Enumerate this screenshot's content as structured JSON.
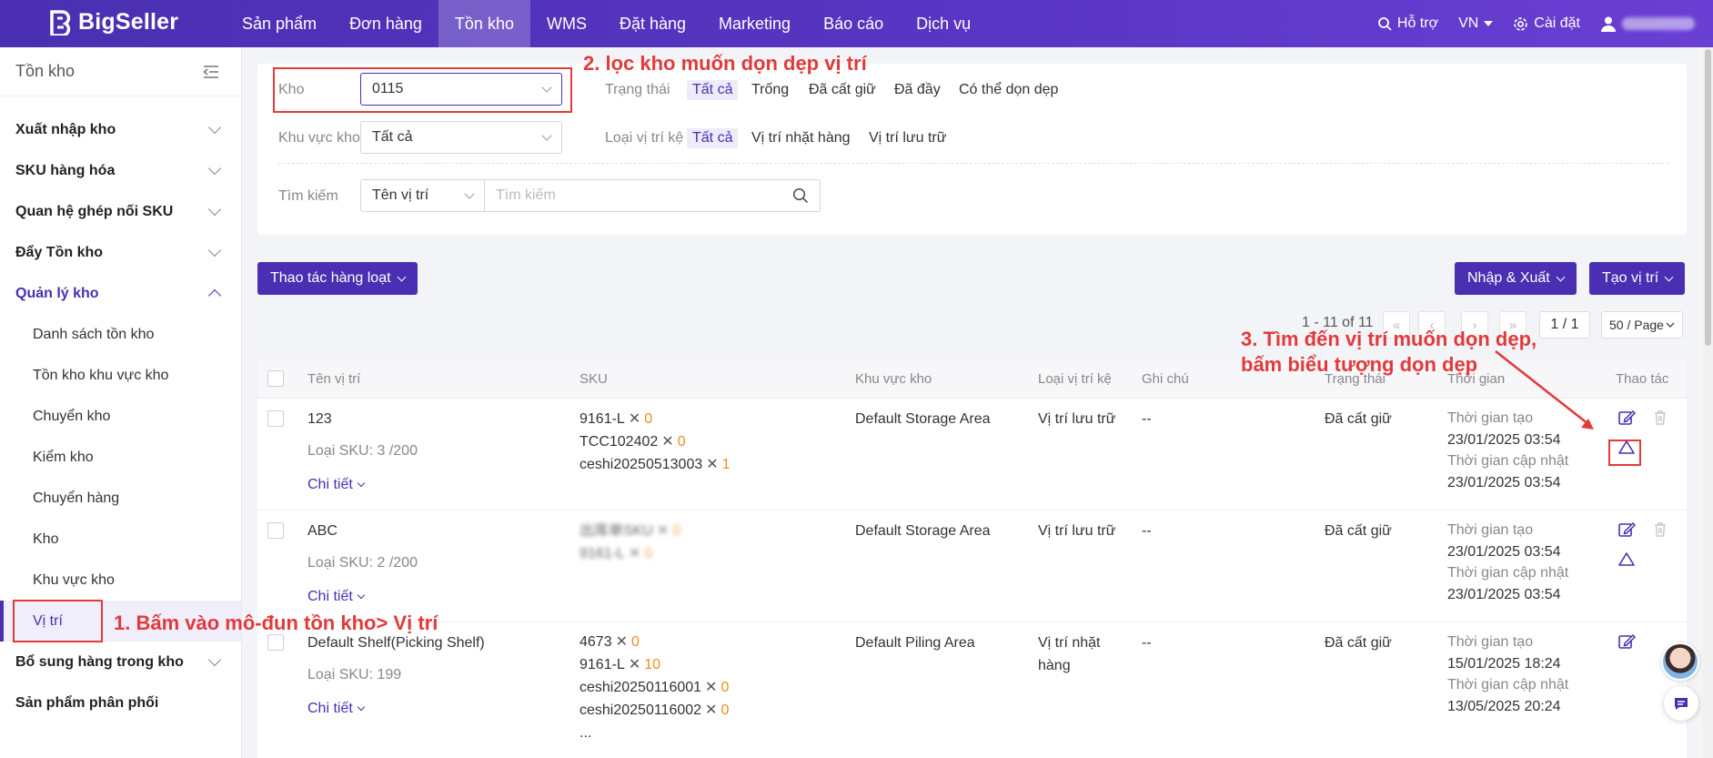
{
  "brand": {
    "name": "BigSeller",
    "accent": "#4a2fb2",
    "annotation_color": "#e23a3a"
  },
  "topnav": {
    "items": [
      "Sản phẩm",
      "Đơn hàng",
      "Tồn kho",
      "WMS",
      "Đặt hàng",
      "Marketing",
      "Báo cáo",
      "Dịch vụ"
    ],
    "active": "Tồn kho",
    "support": "Hỗ trợ",
    "lang": "VN",
    "settings": "Cài đặt"
  },
  "sidebar": {
    "title": "Tồn kho",
    "groups": [
      {
        "label": "Xuất nhập kho"
      },
      {
        "label": "SKU hàng hóa"
      },
      {
        "label": "Quan hệ ghép nối SKU"
      },
      {
        "label": "Đẩy Tồn kho"
      },
      {
        "label": "Quản lý kho"
      }
    ],
    "subitems": [
      "Danh sách tồn kho",
      "Tồn kho khu vực kho",
      "Chuyển kho",
      "Kiểm kho",
      "Chuyển hàng",
      "Kho",
      "Khu vực kho",
      "Vị trí"
    ],
    "active_sub": "Vị trí",
    "after_groups": [
      {
        "label": "Bổ sung hàng trong kho"
      },
      {
        "label": "Sản phẩm phân phối"
      }
    ]
  },
  "filters": {
    "warehouse_label": "Kho",
    "warehouse_value": "0115",
    "status_label": "Trạng thái",
    "status_options": [
      "Tất cả",
      "Trống",
      "Đã cất giữ",
      "Đã đầy",
      "Có thể dọn dẹp"
    ],
    "area_label": "Khu vực kho",
    "area_value": "Tất cả",
    "shelf_type_label": "Loại vị trí kệ",
    "shelf_type_options": [
      "Tất cả",
      "Vị trí nhặt hàng",
      "Vị trí lưu trữ"
    ],
    "search_label": "Tìm kiếm",
    "search_field": "Tên vị trí",
    "search_placeholder": "Tìm kiếm"
  },
  "toolbar": {
    "bulk": "Thao tác hàng loạt",
    "import_export": "Nhập & Xuất",
    "create": "Tạo vị trí"
  },
  "pagination": {
    "range": "1 - 11 of 11",
    "page": "1 / 1",
    "page_size": "50 / Page"
  },
  "table": {
    "headers": [
      "Tên vị trí",
      "SKU",
      "Khu vực kho",
      "Loại vị trí kệ",
      "Ghi chú",
      "Trạng thái",
      "Thời gian",
      "Thao tác"
    ],
    "detail_label": "Chi tiết",
    "created_label": "Thời gian tạo",
    "updated_label": "Thời gian cập nhật",
    "rows": [
      {
        "name": "123",
        "sku_type": "Loại SKU: 3 /200",
        "skus": [
          [
            "9161-L",
            "0"
          ],
          [
            "TCC102402",
            "0"
          ],
          [
            "ceshi20250513003",
            "1"
          ]
        ],
        "area": "Default Storage Area",
        "shelf_type": "Vị trí lưu trữ",
        "note": "--",
        "status": "Đã cất giữ",
        "created": "23/01/2025 03:54",
        "updated": "23/01/2025 03:54"
      },
      {
        "name": "ABC",
        "sku_type": "Loại SKU: 2 /200",
        "skus": [
          [
            "出库单SKU",
            "0"
          ],
          [
            "9161-L",
            "0"
          ]
        ],
        "area": "Default Storage Area",
        "shelf_type": "Vị trí lưu trữ",
        "note": "--",
        "status": "Đã cất giữ",
        "created": "23/01/2025 03:54",
        "updated": "23/01/2025 03:54"
      },
      {
        "name": "Default Shelf(Picking Shelf)",
        "sku_type": "Loại SKU: 199",
        "skus": [
          [
            "4673",
            "0"
          ],
          [
            "9161-L",
            "10"
          ],
          [
            "ceshi20250116001",
            "0"
          ],
          [
            "ceshi20250116002",
            "0"
          ]
        ],
        "more": "...",
        "area": "Default Piling Area",
        "shelf_type": "Vị trí nhặt hàng",
        "note": "--",
        "status": "Đã cất giữ",
        "created": "15/01/2025 18:24",
        "updated": "13/05/2025 20:24"
      }
    ]
  },
  "annotations": {
    "step1": "1. Bấm vào mô-đun tồn kho> Vị trí",
    "step2": "2. lọc kho muốn dọn dẹp vị trí",
    "step3_line1": "3. Tìm đến vị trí muốn dọn dẹp,",
    "step3_line2": "bấm biểu tượng dọn dẹp"
  }
}
